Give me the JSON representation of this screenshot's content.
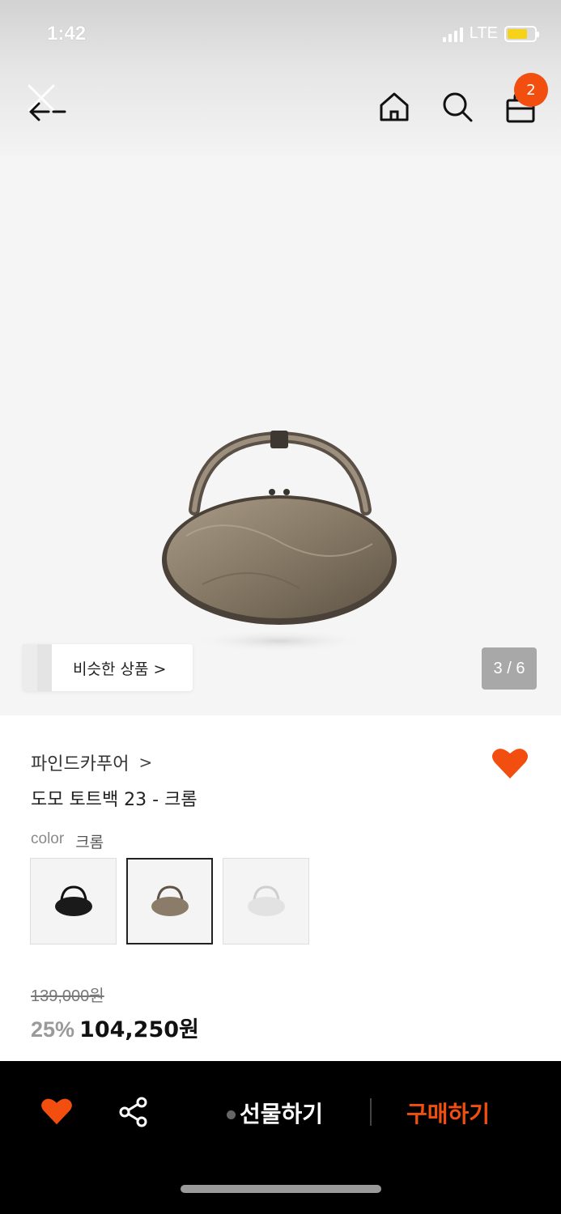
{
  "status_bar": {
    "time": "1:42",
    "network": "LTE"
  },
  "header": {
    "cart_count": "2",
    "icons": [
      "back-icon",
      "home-icon",
      "search-icon",
      "shopping-bag-icon"
    ]
  },
  "gallery": {
    "similar_label": "비슷한 상품 >",
    "page_indicator": "3 / 6"
  },
  "product": {
    "brand": "파인드카푸어",
    "brand_chevron": ">",
    "name": "도모 토트백 23 - 크롬",
    "color_label": "color",
    "color_value": "크롬",
    "swatches": [
      {
        "color": "#1a1a1a",
        "selected": false
      },
      {
        "color": "#7a6a58",
        "selected": true
      },
      {
        "color": "#e0e0e0",
        "selected": false
      }
    ],
    "original_price": "139,000원",
    "discount": "25%",
    "sale_price": "104,250원",
    "accent_color": "#f24e10"
  },
  "bottom_bar": {
    "gift_label": "선물하기",
    "buy_label": "구매하기"
  }
}
